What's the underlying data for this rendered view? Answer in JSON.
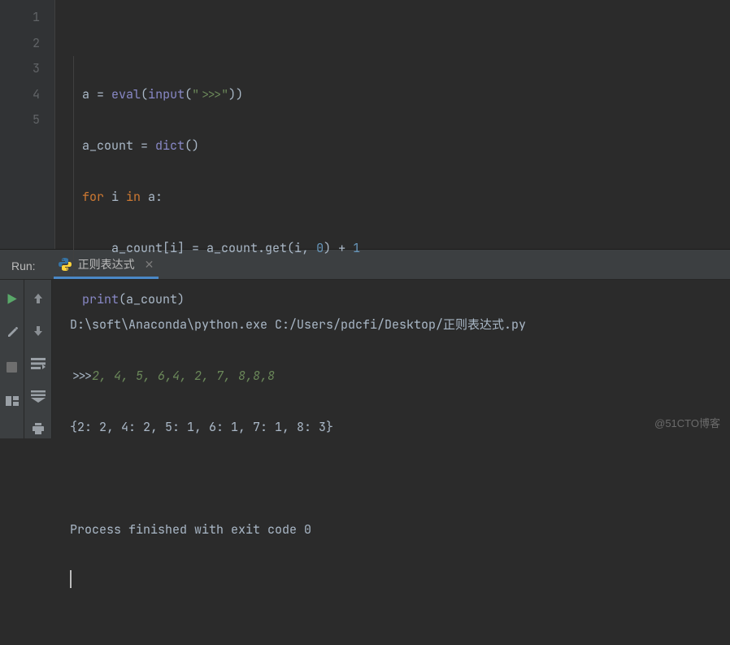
{
  "editor": {
    "line_numbers": [
      "1",
      "2",
      "3",
      "4",
      "5"
    ],
    "code": {
      "l1": {
        "a": "a ",
        "eq": "= ",
        "eval": "eval",
        "p1": "(",
        "input": "input",
        "p2": "(",
        "str": "\">>>\"",
        "p3": "))"
      },
      "l2": {
        "a": "a_count ",
        "eq": "= ",
        "dict": "dict",
        "p": "()"
      },
      "l3": {
        "for": "for",
        "sp": " i ",
        "in": "in",
        "tail": " a:"
      },
      "l4": {
        "indent": "    ",
        "lhs": "a_count[i] ",
        "eq": "= ",
        "rhs1": "a_count.get(i",
        "comma": ", ",
        "zero": "0",
        "rhs2": ") + ",
        "one": "1"
      },
      "l5": {
        "print": "print",
        "p1": "(",
        "arg": "a_count",
        "p2": ")"
      }
    }
  },
  "run": {
    "label": "Run:",
    "tab_name": "正则表达式",
    "cmd": "D:\\soft\\Anaconda\\python.exe C:/Users/pdcfi/Desktop/正则表达式.py",
    "prompt": ">>>",
    "input": "2, 4, 5, 6,4, 2, 7, 8,8,8",
    "output": "{2: 2, 4: 2, 5: 1, 6: 1, 7: 1, 8: 3}",
    "exit": "Process finished with exit code 0"
  },
  "watermark": "@51CTO博客"
}
